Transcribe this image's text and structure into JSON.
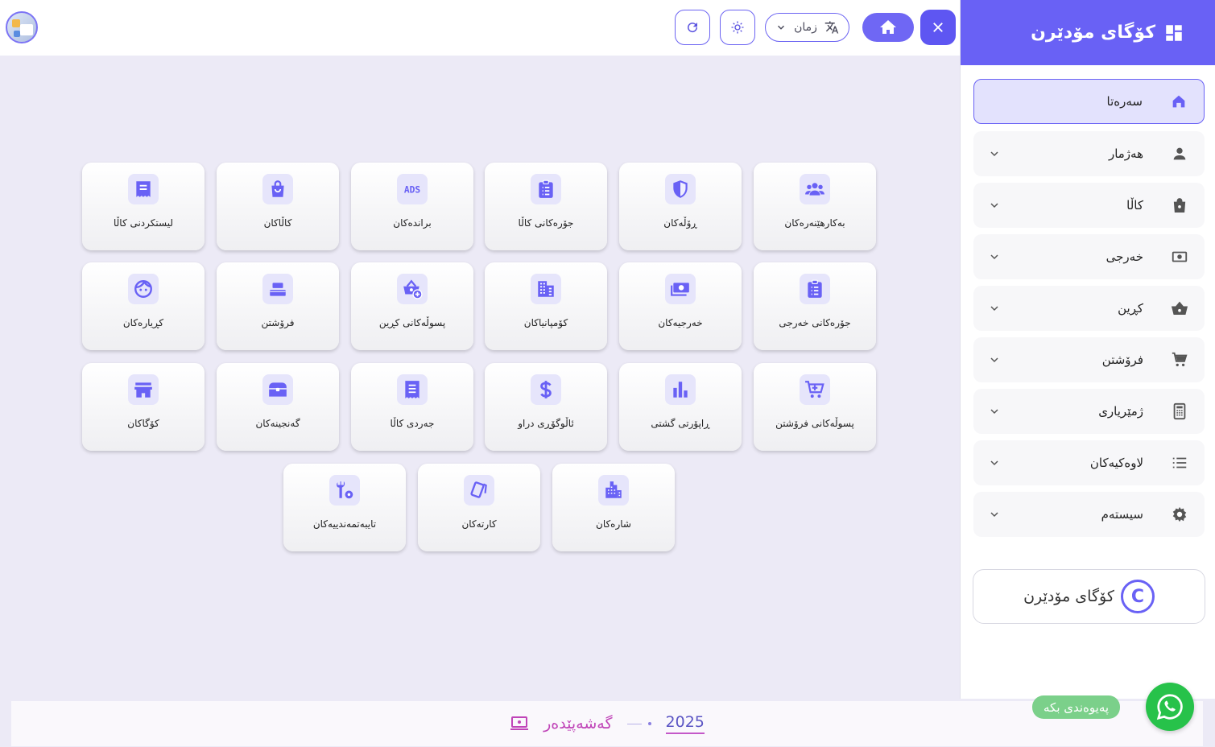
{
  "topbar": {
    "language_label": "زمان"
  },
  "sidebar": {
    "brand": "کۆگای مۆدێرن",
    "items": [
      {
        "label": "سەرەتا",
        "icon": "home-icon",
        "active": true
      },
      {
        "label": "هەژمار",
        "icon": "person-icon"
      },
      {
        "label": "کاڵا",
        "icon": "shopping-bag-icon"
      },
      {
        "label": "خەرجی",
        "icon": "cash-icon"
      },
      {
        "label": "کڕین",
        "icon": "basket-icon"
      },
      {
        "label": "فرۆشتن",
        "icon": "cart-icon"
      },
      {
        "label": "ژمێریاری",
        "icon": "calculator-icon"
      },
      {
        "label": "لاوەکیەکان",
        "icon": "list-icon"
      },
      {
        "label": "سیستەم",
        "icon": "gear-icon"
      }
    ],
    "copyright_text": "کۆگای مۆدێرن",
    "copyright_symbol": "C"
  },
  "cards": [
    {
      "label": "بەکارهێنەرەکان",
      "icon": "users-icon"
    },
    {
      "label": "ڕۆڵەکان",
      "icon": "shield-icon"
    },
    {
      "label": "جۆرەکانی کاڵا",
      "icon": "clipboard-list-icon"
    },
    {
      "label": "براندەکان",
      "icon": "ads-icon"
    },
    {
      "label": "کاڵاکان",
      "icon": "shopping-bag-icon"
    },
    {
      "label": "لیستکردنی کاڵا",
      "icon": "receipt-icon"
    },
    {
      "label": "جۆرەکانی خەرجی",
      "icon": "clipboard-list-icon"
    },
    {
      "label": "خەرجیەکان",
      "icon": "money-icon"
    },
    {
      "label": "کۆمپانیاکان",
      "icon": "building-icon"
    },
    {
      "label": "پسوڵەکانی کڕین",
      "icon": "basket-add-icon"
    },
    {
      "label": "فرۆشتن",
      "icon": "register-icon"
    },
    {
      "label": "کڕیارەکان",
      "icon": "face-icon"
    },
    {
      "label": "پسوڵەکانی فرۆشتن",
      "icon": "cart-icon"
    },
    {
      "label": "ڕاپۆرتی گشتی",
      "icon": "bar-chart-icon"
    },
    {
      "label": "ئاڵوگۆڕی دراو",
      "icon": "dollar-icon"
    },
    {
      "label": "جەردی کاڵا",
      "icon": "receipt-long-icon"
    },
    {
      "label": "گەنجینەکان",
      "icon": "chest-icon"
    },
    {
      "label": "کۆگاکان",
      "icon": "store-icon"
    },
    {
      "label": "شارەکان",
      "icon": "city-icon"
    },
    {
      "label": "کارتەکان",
      "icon": "cards-icon"
    },
    {
      "label": "تایبەتمەندییەکان",
      "icon": "tools-icon"
    }
  ],
  "footer": {
    "year": "2025",
    "developer": "گەشەپێدەر"
  },
  "whatsapp": {
    "label": "پەیوەندی بکە"
  },
  "colors": {
    "accent": "#6961f5",
    "whatsapp": "#27c24a"
  }
}
